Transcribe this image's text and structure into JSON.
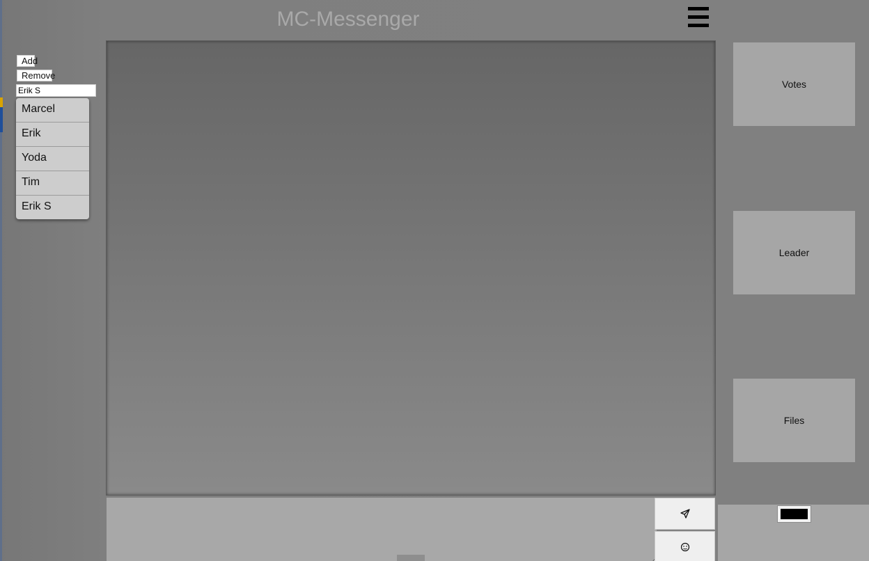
{
  "header": {
    "title": "MC-Messenger",
    "menu_icon": "hamburger-menu-icon"
  },
  "users": {
    "add_label": "Add",
    "remove_label": "Remove",
    "input_value": "Erik S",
    "items": [
      {
        "label": "Marcel"
      },
      {
        "label": "Erik"
      },
      {
        "label": "Yoda"
      },
      {
        "label": "Tim"
      },
      {
        "label": "Erik S"
      }
    ]
  },
  "composer": {
    "send_icon": "paper-plane-icon",
    "emoji_icon": "smiley-face-icon"
  },
  "side_panels": {
    "votes": "Votes",
    "leader": "Leader",
    "files": "Files"
  },
  "color_picker": {
    "value": "#000000"
  }
}
